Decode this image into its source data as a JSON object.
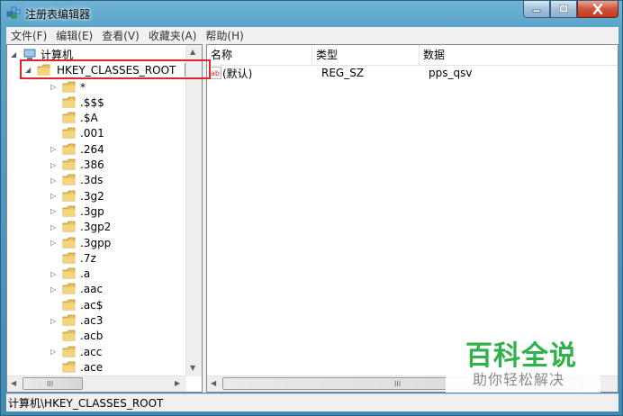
{
  "window": {
    "title": "注册表编辑器",
    "buttons": {
      "minimize": "min",
      "maximize": "max",
      "close": "close"
    }
  },
  "menu": [
    "文件(F)",
    "编辑(E)",
    "查看(V)",
    "收藏夹(A)",
    "帮助(H)"
  ],
  "tree": {
    "root": "计算机",
    "selected": "HKEY_CLASSES_ROOT",
    "children": [
      "*",
      ".$$$",
      ".$A",
      ".001",
      ".264",
      ".386",
      ".3ds",
      ".3g2",
      ".3gp",
      ".3gp2",
      ".3gpp",
      ".7z",
      ".a",
      ".aac",
      ".ac$",
      ".ac3",
      ".acb",
      ".acc",
      ".ace"
    ],
    "children_expandable": [
      true,
      false,
      false,
      false,
      true,
      true,
      true,
      true,
      true,
      true,
      true,
      false,
      true,
      true,
      false,
      true,
      false,
      true,
      false
    ]
  },
  "list": {
    "columns": [
      "名称",
      "类型",
      "数据"
    ],
    "rows": [
      {
        "name": "(默认)",
        "type": "REG_SZ",
        "data": "pps_qsv"
      }
    ]
  },
  "statusbar": {
    "path": "计算机\\HKEY_CLASSES_ROOT"
  },
  "scrollbar": {
    "h_grip": "III"
  },
  "watermark": {
    "title": "百科全说",
    "subtitle": "助你轻松解决"
  },
  "colors": {
    "accent_highlight": "#e3242b",
    "watermark_green": "#2db34a",
    "folder": "#e8c15a"
  }
}
